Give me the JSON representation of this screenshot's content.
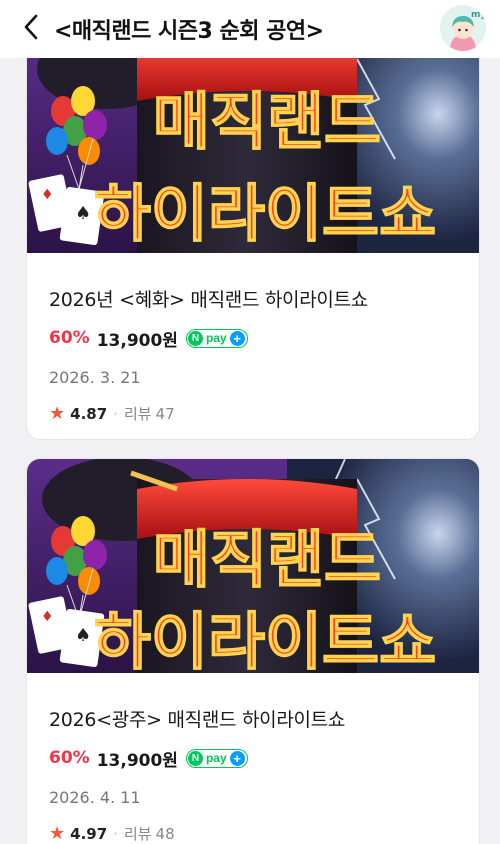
{
  "header": {
    "title": "<매직랜드 시즌3 순회 공연>",
    "back_icon": "chevron-left-icon",
    "avatar_text": "my"
  },
  "products": [
    {
      "poster": {
        "line1": "매직랜드",
        "line2": "하이라이트쇼"
      },
      "title": "2026년 <혜화> 매직랜드 하이라이트쇼",
      "discount": "60%",
      "price": "13,900원",
      "npay": {
        "n": "N",
        "text": "pay",
        "plus": "+"
      },
      "date": "2026. 3. 21",
      "rating": "4.87",
      "review_label": "리뷰",
      "review_count": "47"
    },
    {
      "poster": {
        "line1": "매직랜드",
        "line2": "하이라이트쇼"
      },
      "title": "2026<광주> 매직랜드 하이라이트쇼",
      "discount": "60%",
      "price": "13,900원",
      "npay": {
        "n": "N",
        "text": "pay",
        "plus": "+"
      },
      "date": "2026. 4. 11",
      "rating": "4.97",
      "review_label": "리뷰",
      "review_count": "48"
    }
  ],
  "colors": {
    "discount": "#f0344c",
    "star": "#f2593d",
    "npay_green": "#03c75a",
    "npay_blue": "#0b9cff",
    "poster_neon": "#ff3b2a"
  }
}
